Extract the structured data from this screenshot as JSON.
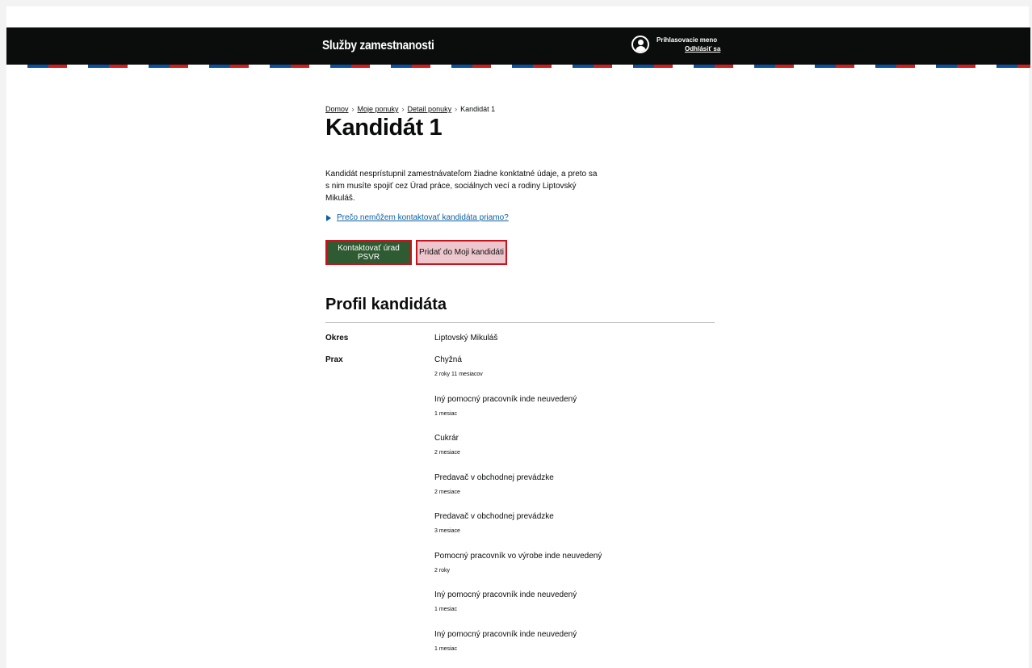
{
  "header": {
    "brand": "Služby zamestnanosti",
    "user_icon": "user-circle-icon",
    "login_name": "Prihlasovacie meno",
    "logout": "Odhlásiť sa"
  },
  "breadcrumb": {
    "items": [
      "Domov",
      "Moje ponuky",
      "Detail ponuky"
    ],
    "current": "Kandidát 1"
  },
  "page_title": "Kandidát 1",
  "intro": "Kandidát nesprístupnil zamestnávateľom žiadne konktatné údaje, a preto sa s nim musíte spojiť cez Úrad práce, sociálnych vecí a rodiny Liptovský Mikuláš.",
  "details_link": "Prečo nemôžem kontaktovať kandidáta priamo?",
  "buttons": {
    "contact": "Kontaktovať úrad PSVR",
    "add": "Pridať do Moji kandidáti"
  },
  "profile": {
    "heading": "Profil kandidáta",
    "okres_label": "Okres",
    "okres_value": "Liptovský Mikuláš",
    "prax_label": "Prax",
    "experience": [
      {
        "title": "Chyžná",
        "duration": "2 roky 11 mesiacov"
      },
      {
        "title": "Iný pomocný pracovník inde neuvedený",
        "duration": "1 mesiac"
      },
      {
        "title": "Cukrár",
        "duration": "2 mesiace"
      },
      {
        "title": "Predavač v obchodnej prevádzke",
        "duration": "2 mesiace"
      },
      {
        "title": "Predavač v obchodnej prevádzke",
        "duration": "3 mesiace"
      },
      {
        "title": "Pomocný pracovník vo výrobe inde neuvedený",
        "duration": "2 roky"
      },
      {
        "title": "Iný pomocný pracovník inde neuvedený",
        "duration": "1 mesiac"
      },
      {
        "title": "Iný pomocný pracovník inde neuvedený",
        "duration": "1 mesiac"
      }
    ]
  },
  "colors": {
    "header_bg": "#0b0c0c",
    "primary_button": "#2e5b31",
    "secondary_button": "#eec7ce",
    "focus_border": "#c8141a",
    "link": "#0b5fa5",
    "stripe_blue": "#0b4f9f",
    "stripe_red": "#cc1f1f"
  }
}
